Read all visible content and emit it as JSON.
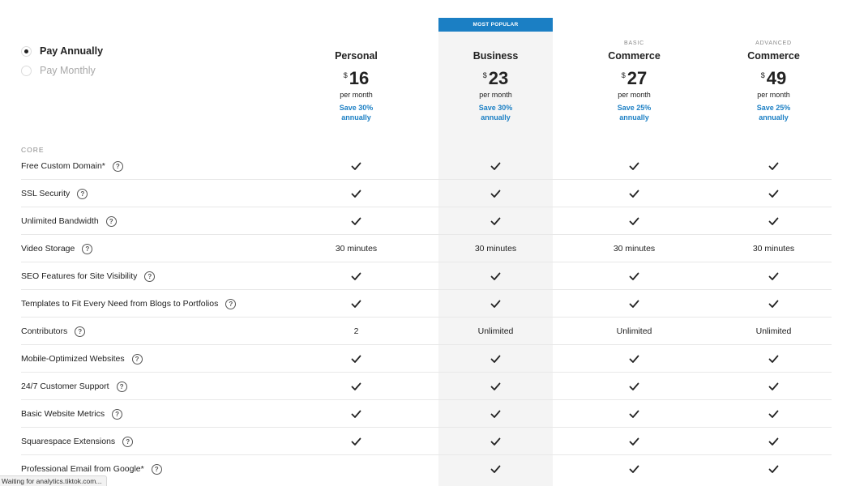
{
  "billing": {
    "options": [
      {
        "label": "Pay Annually",
        "selected": true
      },
      {
        "label": "Pay Monthly",
        "selected": false
      }
    ]
  },
  "banner": {
    "label": "MOST POPULAR"
  },
  "plans": [
    {
      "tier": "",
      "name": "Personal",
      "currency": "$",
      "price": "16",
      "period": "per month",
      "save": "Save 30% annually"
    },
    {
      "tier": "",
      "name": "Business",
      "currency": "$",
      "price": "23",
      "period": "per month",
      "save": "Save 30% annually"
    },
    {
      "tier": "BASIC",
      "name": "Commerce",
      "currency": "$",
      "price": "27",
      "period": "per month",
      "save": "Save 25% annually"
    },
    {
      "tier": "ADVANCED",
      "name": "Commerce",
      "currency": "$",
      "price": "49",
      "period": "per month",
      "save": "Save 25% annually"
    }
  ],
  "section": {
    "label": "CORE"
  },
  "help_glyph": "?",
  "features": [
    {
      "name": "Free Custom Domain*",
      "values": [
        "check",
        "check",
        "check",
        "check"
      ]
    },
    {
      "name": "SSL Security",
      "values": [
        "check",
        "check",
        "check",
        "check"
      ]
    },
    {
      "name": "Unlimited Bandwidth",
      "values": [
        "check",
        "check",
        "check",
        "check"
      ]
    },
    {
      "name": "Video Storage",
      "values": [
        "30 minutes",
        "30 minutes",
        "30 minutes",
        "30 minutes"
      ]
    },
    {
      "name": "SEO Features for Site Visibility",
      "values": [
        "check",
        "check",
        "check",
        "check"
      ]
    },
    {
      "name": "Templates to Fit Every Need from Blogs to Portfolios",
      "values": [
        "check",
        "check",
        "check",
        "check"
      ]
    },
    {
      "name": "Contributors",
      "values": [
        "2",
        "Unlimited",
        "Unlimited",
        "Unlimited"
      ]
    },
    {
      "name": "Mobile-Optimized Websites",
      "values": [
        "check",
        "check",
        "check",
        "check"
      ]
    },
    {
      "name": "24/7 Customer Support",
      "values": [
        "check",
        "check",
        "check",
        "check"
      ]
    },
    {
      "name": "Basic Website Metrics",
      "values": [
        "check",
        "check",
        "check",
        "check"
      ]
    },
    {
      "name": "Squarespace Extensions",
      "values": [
        "check",
        "check",
        "check",
        "check"
      ]
    },
    {
      "name": "Professional Email from Google*",
      "values": [
        "",
        "check",
        "check",
        "check"
      ]
    }
  ],
  "status_bar": {
    "text": "Waiting for analytics.tiktok.com..."
  },
  "colors": {
    "accent": "#1b7fc4",
    "highlight_bg": "#f4f4f4",
    "text": "#222222",
    "muted": "#8a8a8a"
  }
}
